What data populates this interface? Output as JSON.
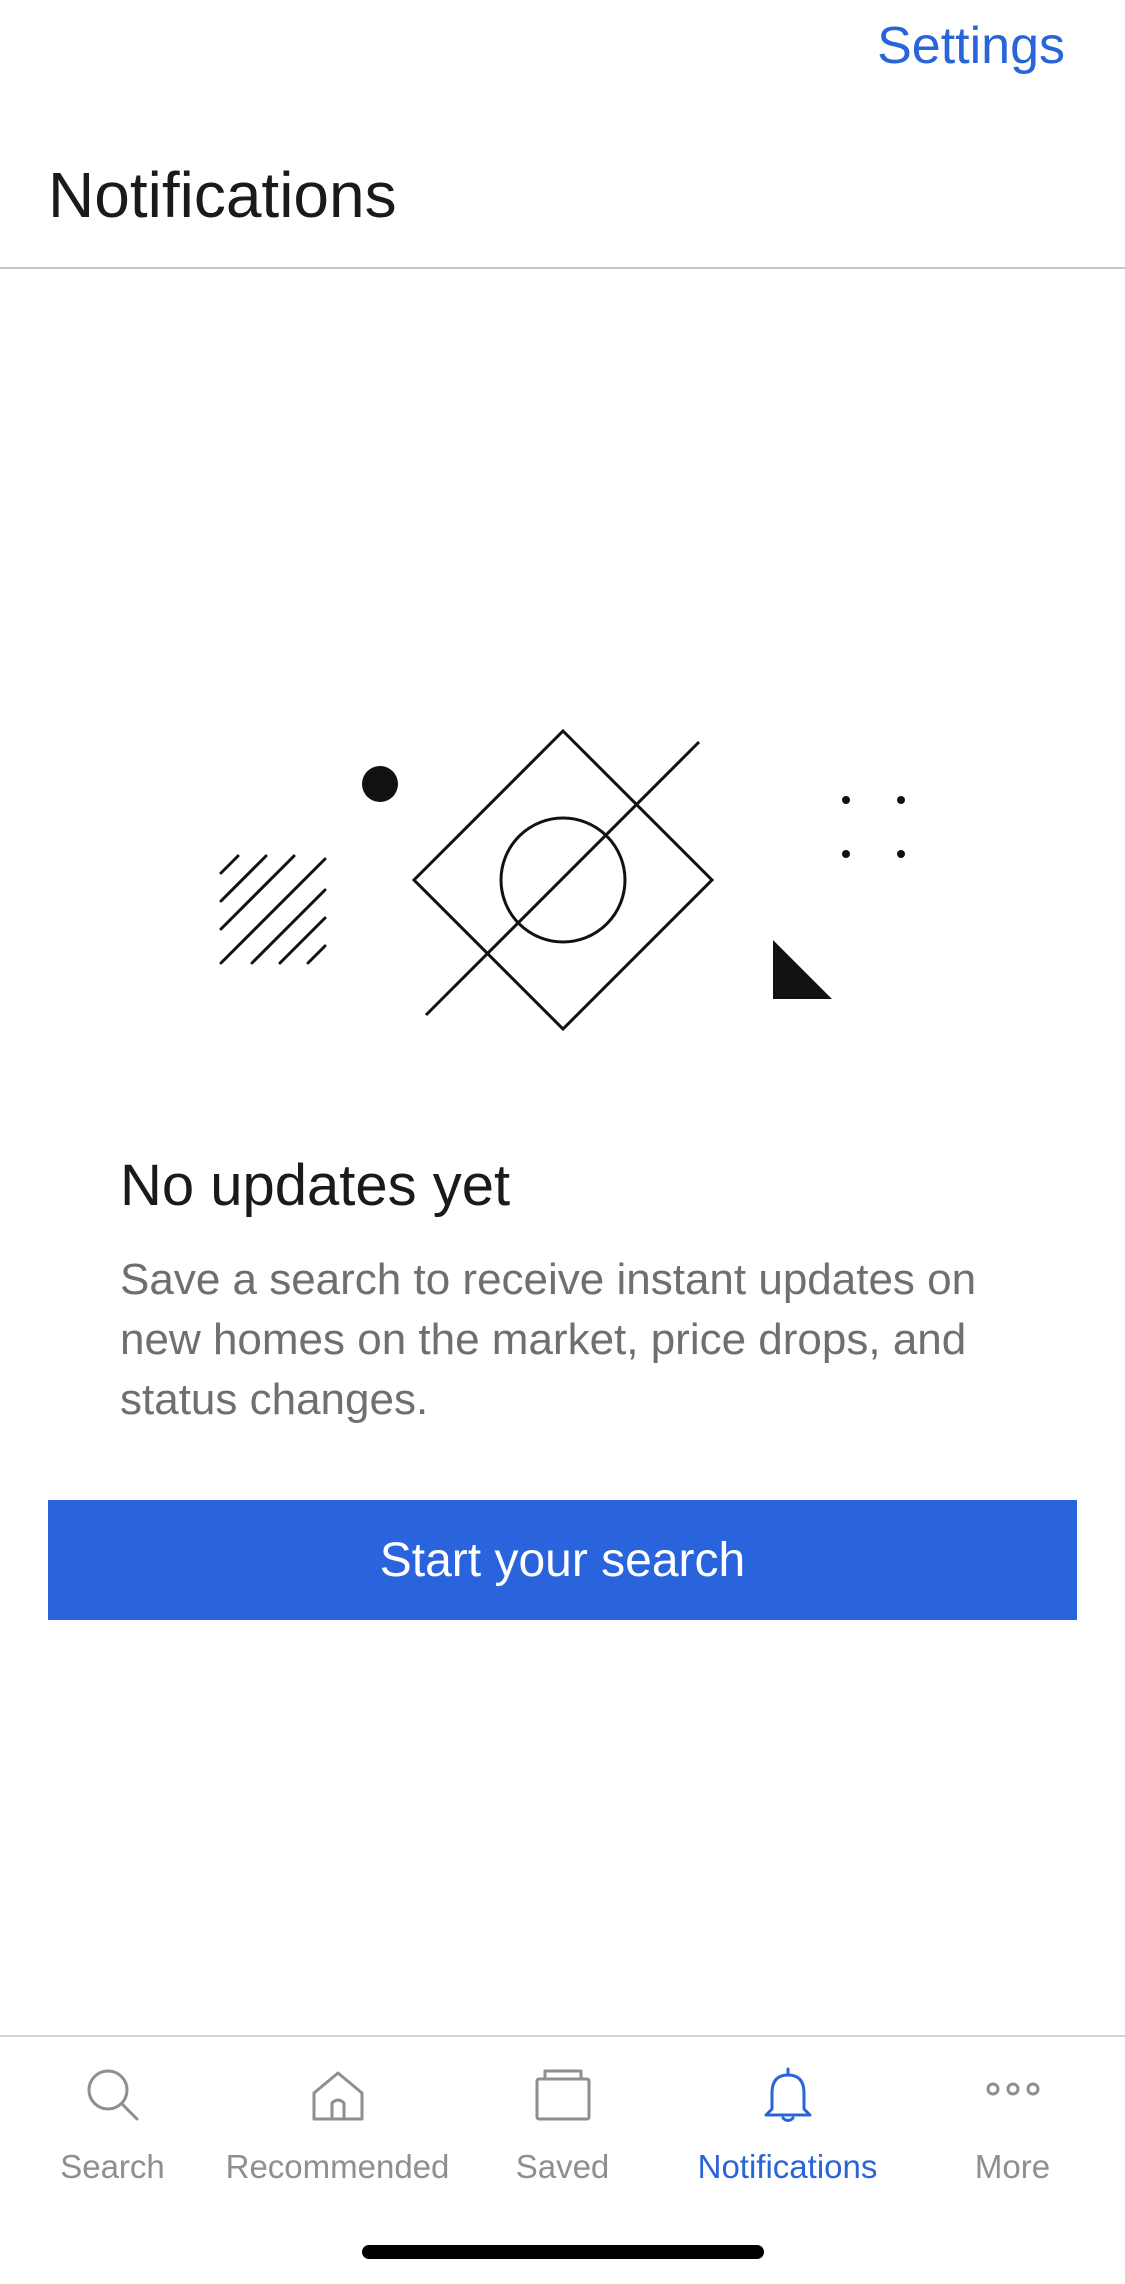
{
  "header": {
    "settings_label": "Settings",
    "title": "Notifications"
  },
  "empty_state": {
    "illustration_icon": "abstract-geometric-illustration",
    "title": "No updates yet",
    "body": "Save a search to receive instant updates on new homes on the market, price drops, and status changes.",
    "cta_label": "Start your search"
  },
  "tab_bar": {
    "active": "Notifications",
    "tabs": [
      {
        "label": "Search",
        "icon": "search-icon"
      },
      {
        "label": "Recommended",
        "icon": "home-icon"
      },
      {
        "label": "Saved",
        "icon": "folder-icon"
      },
      {
        "label": "Notifications",
        "icon": "bell-icon"
      },
      {
        "label": "More",
        "icon": "more-icon"
      }
    ]
  },
  "colors": {
    "accent": "#2a64d9",
    "button": "#2a64dd",
    "inactive_tab": "#8e8e93",
    "body_text": "#6e6e73"
  }
}
